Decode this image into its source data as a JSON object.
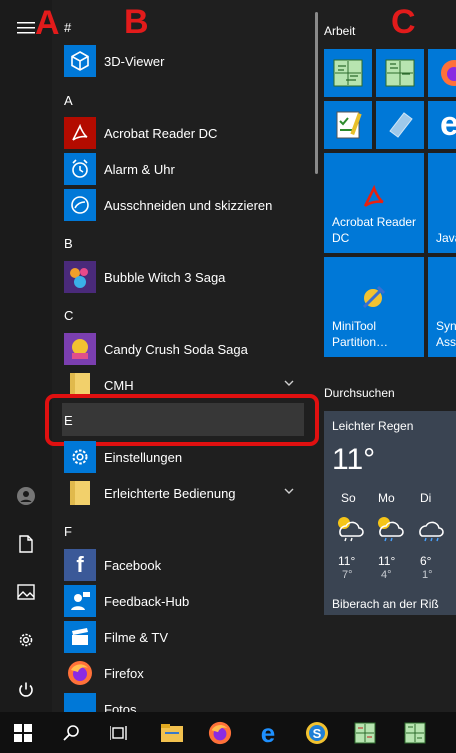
{
  "annotations": {
    "a": "A",
    "b": "B",
    "c": "C"
  },
  "rail": {
    "icons": [
      "hamburger-icon",
      "user-icon",
      "document-icon",
      "pictures-icon",
      "settings-icon",
      "power-icon"
    ]
  },
  "app_list": {
    "headers": {
      "hash": "#",
      "a": "A",
      "b": "B",
      "c": "C",
      "e": "E",
      "f": "F"
    },
    "apps": {
      "viewer3d": "3D-Viewer",
      "acrobat": "Acrobat Reader DC",
      "alarm": "Alarm & Uhr",
      "snip": "Ausschneiden und skizzieren",
      "bubble": "Bubble Witch 3 Saga",
      "candy": "Candy Crush Soda Saga",
      "cmh": "CMH",
      "settings": "Einstellungen",
      "ease": "Erleichterte Bedienung",
      "facebook": "Facebook",
      "feedback": "Feedback-Hub",
      "films": "Filme & TV",
      "firefox": "Firefox",
      "photos": "Fotos"
    }
  },
  "tiles": {
    "group_work": "Arbeit",
    "group_browse": "Durchsuchen",
    "acrobat_label": "Acrobat Reader DC",
    "java_label": "Java",
    "minitool_label": "MiniTool Partition…",
    "sync_label": "Sync Assi"
  },
  "weather": {
    "title": "Leichter Regen",
    "temp": "11°",
    "days": [
      {
        "day": "So",
        "high": "11°",
        "low": "7°"
      },
      {
        "day": "Mo",
        "high": "11°",
        "low": "4°"
      },
      {
        "day": "Di",
        "high": "6°",
        "low": "1°"
      }
    ],
    "location": "Biberach an der Riß"
  },
  "taskbar": {
    "icons": [
      "windows-start-icon",
      "search-icon",
      "task-view-icon",
      "file-explorer-icon",
      "firefox-icon",
      "edge-icon",
      "app-s-icon",
      "app-chart1-icon",
      "app-chart2-icon"
    ]
  },
  "colors": {
    "accent": "#0078d7",
    "annotation_red": "#e21b1b"
  }
}
